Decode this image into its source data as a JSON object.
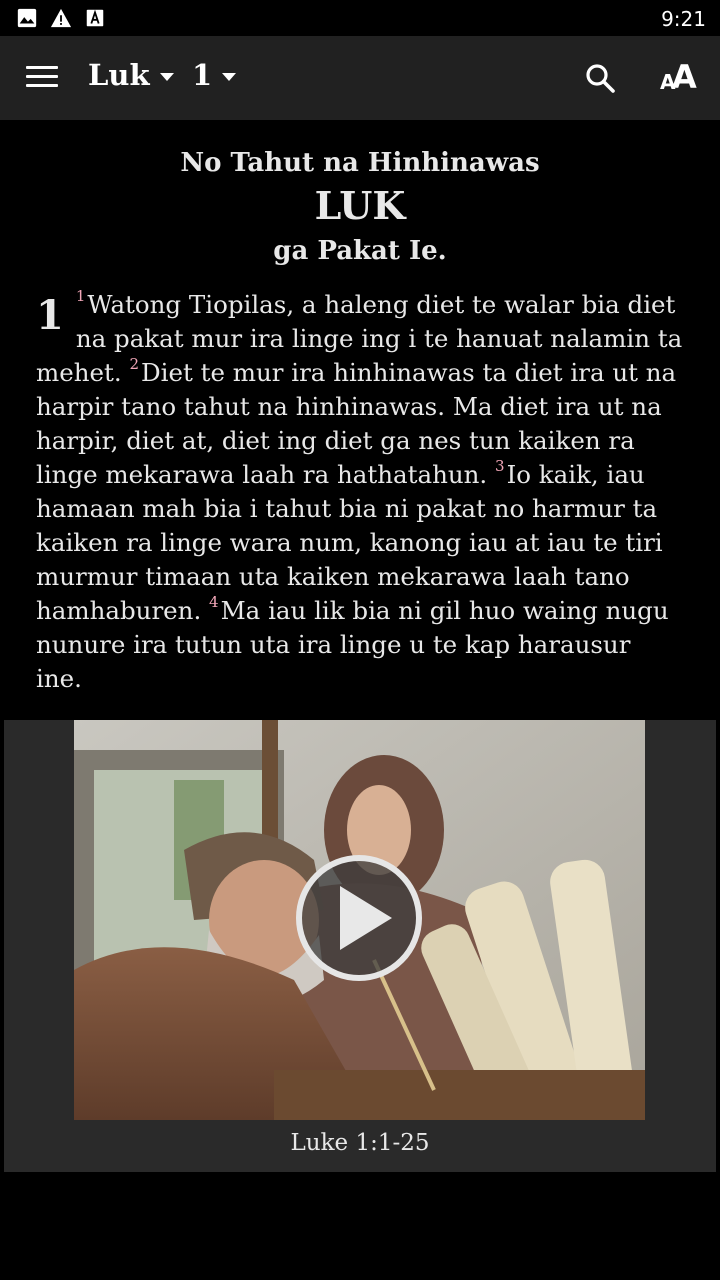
{
  "status": {
    "time": "9:21",
    "icons": [
      "image-icon",
      "warning-icon",
      "font-download-icon"
    ]
  },
  "appbar": {
    "book": "Luk",
    "chapter": "1",
    "icons": [
      "menu-icon",
      "search-icon",
      "text-size-icon"
    ]
  },
  "heading": {
    "main": "No Tahut na Hinhinawas",
    "book": "LUK",
    "sub": "ga Pakat Ie."
  },
  "passage": {
    "chapter": "1",
    "verses": [
      {
        "num": "1",
        "text": "Watong Tiopilas, a haleng diet te walar bia diet na pakat mur ira linge ing i te hanuat nalamin ta mehet."
      },
      {
        "num": "2",
        "text": "Diet te mur ira hinhinawas ta diet ira ut na harpir tano tahut na hinhinawas. Ma diet ira ut na harpir, diet at, diet ing diet ga nes tun kaiken ra linge mekarawa laah ra hathatahun."
      },
      {
        "num": "3",
        "text": "Io kaik, iau hamaan mah bia i tahut bia ni pakat no harmur ta kaiken ra linge wara num, kanong iau at iau te tiri murmur timaan uta kaiken mekarawa laah tano hamhaburen."
      },
      {
        "num": "4",
        "text": "Ma iau lik bia ni gil huo waing nugu nunure ira tutun uta ira linge u te kap harausur ine."
      }
    ]
  },
  "video": {
    "caption": "Luke 1:1-25",
    "icon": "play-icon"
  },
  "colors": {
    "background": "#000000",
    "appbar": "#212121",
    "verse_number": "#f2a7b8",
    "video_panel": "#2a2a2a"
  }
}
